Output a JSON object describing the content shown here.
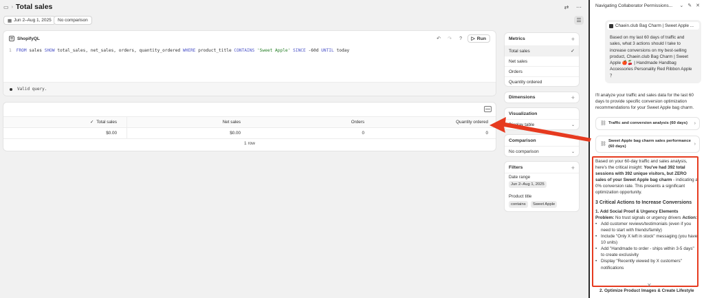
{
  "header": {
    "title": "Total sales",
    "date_range": "Jun 2–Aug 1, 2025",
    "comparison": "No comparison"
  },
  "editor": {
    "label": "ShopifyQL",
    "run_label": "Run",
    "line_number": "1",
    "query_tokens": {
      "from": "FROM",
      "table": " sales ",
      "show": "SHOW",
      "fields": " total_sales, net_sales, orders, quantity_ordered ",
      "where": "WHERE",
      "cond_field": " product_title ",
      "contains": "CONTAINS",
      "cond_value": " 'Sweet Apple' ",
      "since": "SINCE",
      "since_val": " -60d ",
      "until": "UNTIL",
      "until_val": " today"
    },
    "status": "Valid query."
  },
  "table": {
    "columns": [
      "Total sales",
      "Net sales",
      "Orders",
      "Quantity ordered"
    ],
    "rows": [
      [
        "$0.00",
        "$0.00",
        "0",
        "0"
      ]
    ],
    "row_count": "1 row"
  },
  "config": {
    "metrics": {
      "title": "Metrics",
      "items": [
        "Total sales",
        "Net sales",
        "Orders",
        "Quantity ordered"
      ]
    },
    "dimensions": {
      "title": "Dimensions"
    },
    "visualization": {
      "title": "Visualization",
      "value": "Display table"
    },
    "comparison": {
      "title": "Comparison",
      "value": "No comparison"
    },
    "filters": {
      "title": "Filters",
      "date_label": "Date range",
      "date_value": "Jun 2–Aug 1, 2025",
      "product_label": "Product title",
      "operator": "contains",
      "value": "Sweet Apple"
    }
  },
  "panel": {
    "title": "Navigating Collaborator Permissions...",
    "user_context": "Chaein.club Bag Charm | Sweet Apple ...",
    "user_message": "Based on my last 60 days of traffic and sales, what 3 actions should I take to increase conversions on my best-selling product, Chaein.club Bag Charm | Sweet Apple 🍎🍒 | Handmade Handbag Accessories Personality Red Ribbon Apple ？",
    "assistant_intro": "I'll analyze your traffic and sales data for the last 60 days to provide specific conversion optimization recommendations for your Sweet Apple bag charm.",
    "tool_cards": [
      "Traffic and conversion analysis (60 days)",
      "Sweet Apple bag charm sales performance (60 days)"
    ],
    "answer": {
      "intro_plain": "Based on your 60-day traffic and sales analysis, here's the critical insight: ",
      "intro_bold": "You've had 392 total sessions with 392 unique visitors, but ZERO sales of your Sweet Apple bag charm",
      "intro_tail": " - indicating a 0% conversion rate. This presents a significant optimization opportunity.",
      "heading": "3 Critical Actions to Increase Conversions",
      "sub1": "1. Add Social Proof & Urgency Elements",
      "problem_label": "Problem:",
      "problem_text": " No trust signals or urgency drivers ",
      "action_label": "Action:",
      "bullets": [
        "Add customer reviews/testimonials (even if you need to start with friends/family)",
        "Include \"Only X left in stock\" messaging (you have 10 units)",
        "Add \"Handmade to order - ships within 3-5 days\" to create exclusivity",
        "Display \"Recently viewed by X customers\" notifications"
      ],
      "sub2": "2. Optimize Product Images & Create Lifestyle"
    }
  },
  "colors": {
    "annotation": "#e63a1f",
    "keyword": "#4a52c8"
  }
}
